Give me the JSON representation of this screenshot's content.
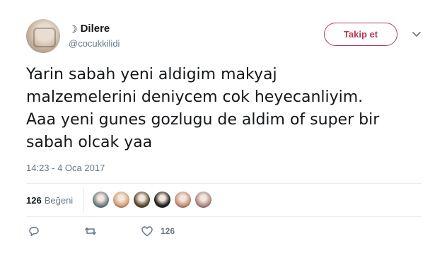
{
  "user": {
    "display_name": "Dilere",
    "name_prefix": "☽",
    "handle": "@cocukkilidi"
  },
  "follow_label": "Takip et",
  "tweet": {
    "text": "Yarin sabah yeni aldigim makyaj\nmalzemelerini deniycem cok heyecanliyim.\nAaa yeni gunes gozlugu de aldim of super bir\nsabah olcak yaa",
    "timestamp": "14:23 - 4 Oca 2017"
  },
  "stats": {
    "likes_count": "126",
    "likes_label": "Beğeni"
  },
  "likers": [
    {
      "icon": "liker-avatar-1",
      "color": "#6f7f86"
    },
    {
      "icon": "liker-avatar-2",
      "color": "#d9a074"
    },
    {
      "icon": "liker-avatar-3",
      "color": "#5a4a2e"
    },
    {
      "icon": "liker-avatar-4",
      "color": "#1f1f1f"
    },
    {
      "icon": "liker-avatar-5",
      "color": "#c98f7b"
    },
    {
      "icon": "liker-avatar-6",
      "color": "#b08a82"
    }
  ],
  "actions": {
    "reply_icon": "reply-icon",
    "retweet_icon": "retweet-icon",
    "like_icon": "heart-icon",
    "like_count": "126"
  },
  "colors": {
    "accent": "#b43b54",
    "secondary_text": "#657786",
    "divider": "#e6ecf0"
  }
}
